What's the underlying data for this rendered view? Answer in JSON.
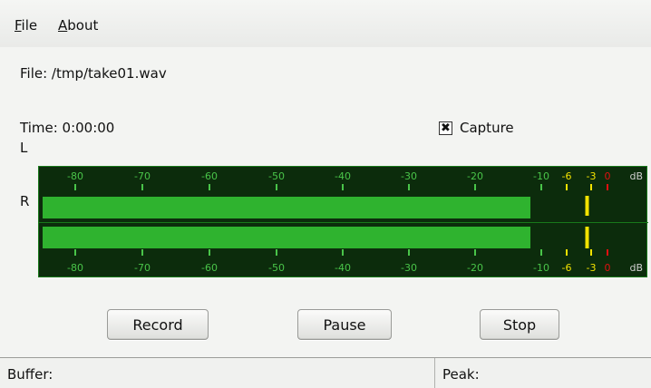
{
  "menu": {
    "file_first": "F",
    "file_rest": "ile",
    "about_first": "A",
    "about_rest": "bout"
  },
  "info": {
    "file": "File: /tmp/take01.wav",
    "time": "Time: 0:00:00"
  },
  "capture": {
    "label": "Capture",
    "checked": true,
    "mark": "✖"
  },
  "meter": {
    "left_label": "L",
    "right_label": "R",
    "scale": [
      "-80",
      "-70",
      "-60",
      "-50",
      "-40",
      "-30",
      "-20",
      "-10",
      "-6",
      "-3",
      "0"
    ],
    "unit": "dB",
    "level_l": -10,
    "level_r": -10,
    "peak_l": -3.5,
    "peak_r": -3.5,
    "colors": {
      "normal": "#2fb32f",
      "warn": "#f2e200",
      "clip": "#e01010",
      "scale_text": "#49c449",
      "bg": "#0c2c0c"
    }
  },
  "buttons": {
    "record": "Record",
    "pause": "Pause",
    "stop": "Stop"
  },
  "status": {
    "buffer": "Buffer:",
    "peak": "Peak:"
  }
}
